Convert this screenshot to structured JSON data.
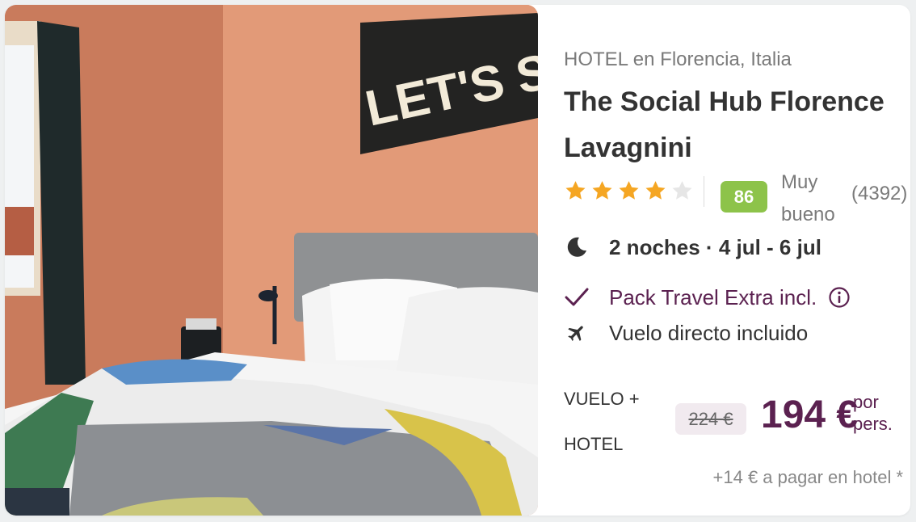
{
  "hotel": {
    "location": "HOTEL en Florencia, Italia",
    "name": "The Social Hub Florence Lavagnini",
    "stars": 4,
    "max_stars": 5,
    "score": "86",
    "score_label": "Muy bueno",
    "reviews": "(4392)"
  },
  "trip": {
    "nights": "2 noches · 4 jul - 6 jul",
    "pack": "Pack Travel Extra incl.",
    "flight": "Vuelo directo incluido"
  },
  "pricing": {
    "type": "VUELO + HOTEL",
    "old_price": "224 €",
    "price": "194 €",
    "per": "por pers.",
    "extra": "+14 € a pagar en hotel *"
  },
  "photo": {
    "banner_text": "LET'S STAY I"
  },
  "colors": {
    "brand": "#5b2150",
    "score_bg": "#8dc34a",
    "star_on": "#f5a623",
    "star_off": "#e6e6e6"
  },
  "icons": {
    "nights": "moon-icon",
    "pack": "check-icon",
    "pack_info": "info-icon",
    "flight": "airplane-icon"
  }
}
